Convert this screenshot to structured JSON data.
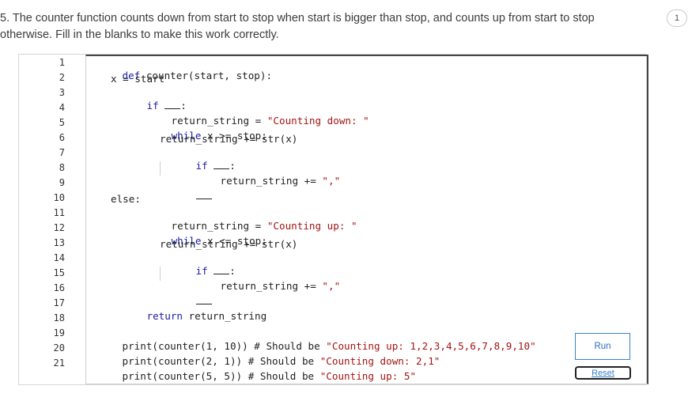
{
  "question": {
    "line1": "5.  The counter function counts down from start to stop when start is bigger than stop, and counts up from start to stop",
    "line2": "     otherwise. Fill in the blanks to make this work correctly.",
    "page_badge": "1"
  },
  "line_numbers": [
    "1",
    "2",
    "3",
    "4",
    "5",
    "6",
    "7",
    "8",
    "9",
    "10",
    "11",
    "12",
    "13",
    "14",
    "15",
    "16",
    "17",
    "18",
    "19",
    "20",
    "21"
  ],
  "code": {
    "l1": "def counter(start, stop):",
    "l2": "x = start",
    "l3_kw": "if",
    "l3_tail": ":",
    "l4_a": "return_string = ",
    "l4_str": "\"Counting down: \"",
    "l5_kw": "while",
    "l5_tail": " x >= stop:",
    "l6": "return_string += str(x)",
    "l7_kw": "if",
    "l7_tail": ":",
    "l8_a": "return_string += ",
    "l8_str": "\",\"",
    "l10": "else:",
    "l11_a": "return_string = ",
    "l11_str": "\"Counting up: \"",
    "l12_kw": "while",
    "l12_tail": " x <= stop:",
    "l13": "return_string += str(x)",
    "l14_kw": "if",
    "l14_tail": ":",
    "l15_a": "return_string += ",
    "l15_str": "\",\"",
    "l17_kw": "return",
    "l17_tail": " return_string",
    "l19_a": "print(counter(1, 10)) # Should be ",
    "l19_str": "\"Counting up: 1,2,3,4,5,6,7,8,9,10\"",
    "l20_a": "print(counter(2, 1)) # Should be ",
    "l20_str": "\"Counting down: 2,1\"",
    "l21_a": "print(counter(5, 5)) # Should be ",
    "l21_str": "\"Counting up: 5\""
  },
  "buttons": {
    "run": "Run",
    "reset": "Reset"
  }
}
